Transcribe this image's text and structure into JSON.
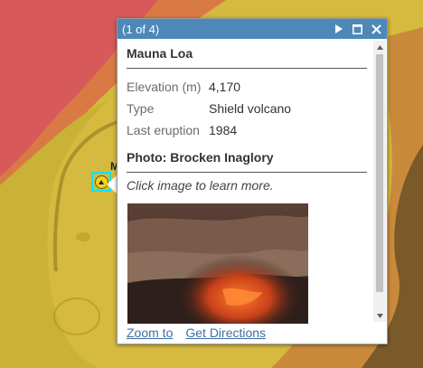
{
  "popup": {
    "title": "(1 of 4)",
    "next_icon": "play-icon",
    "maximize_icon": "maximize-icon",
    "close_icon": "close-icon",
    "feature_name": "Mauna Loa",
    "attributes": [
      {
        "key": "Elevation (m)",
        "value": "4,170"
      },
      {
        "key": "Type",
        "value": "Shield volcano"
      },
      {
        "key": "Last eruption",
        "value": "1984"
      }
    ],
    "photo_heading": "Photo: Brocken Inaglory",
    "photo_caption": "Click image to learn more.",
    "links": {
      "zoom": "Zoom to",
      "directions": "Get Directions"
    }
  },
  "marker": {
    "label": "M"
  },
  "colors": {
    "titlebar": "#4d88b9",
    "link": "#3c6fa6",
    "zone_red": "#d9595b",
    "zone_orange": "#e07a39",
    "zone_yellow": "#d8c23a",
    "zone_brown": "#7a5a2a",
    "highlight": "#00e5ff"
  }
}
